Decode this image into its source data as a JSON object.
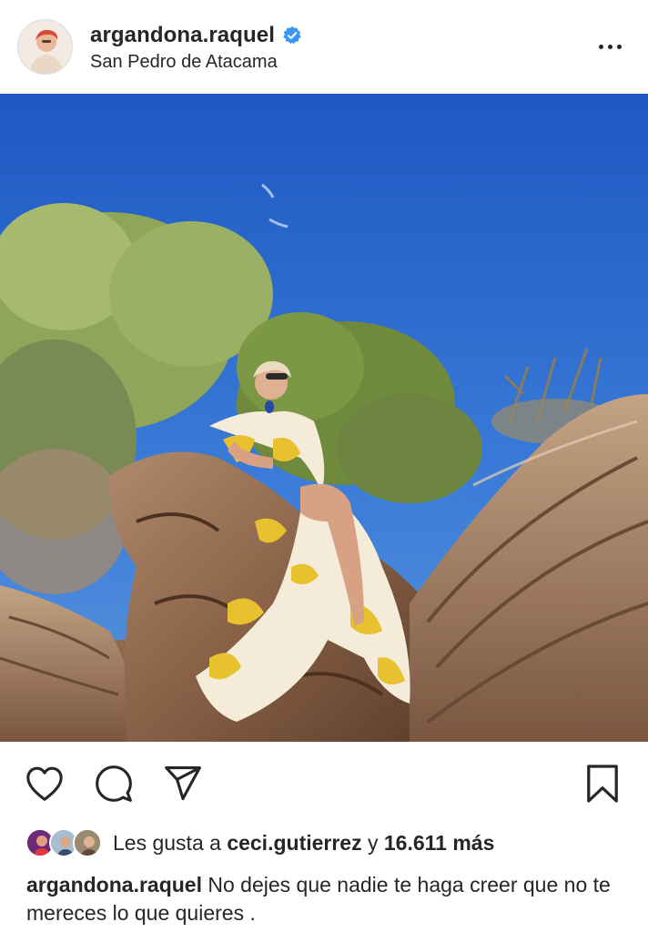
{
  "post": {
    "username": "argandona.raquel",
    "location": "San Pedro de Atacama",
    "verified": true
  },
  "icons": {
    "verified": "verified-badge-icon",
    "more": "more-options-icon",
    "like": "heart-icon",
    "comment": "comment-icon",
    "share": "send-icon",
    "save": "bookmark-icon"
  },
  "likes": {
    "prefix": "Les gusta a ",
    "user": "ceci.gutierrez",
    "joiner": " y ",
    "count": "16.611 más"
  },
  "caption": {
    "username": "argandona.raquel",
    "text": "No dejes que nadie te haga creer que no te mereces lo que quieres ."
  },
  "colors": {
    "verified_blue": "#3897f0",
    "text": "#262626",
    "sky": "#2f6fd0"
  }
}
